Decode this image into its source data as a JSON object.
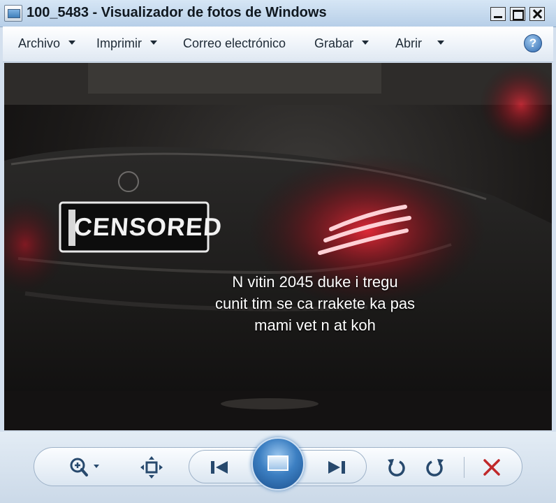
{
  "window": {
    "title": "100_5483 - Visualizador de fotos de Windows"
  },
  "menu": {
    "items": [
      {
        "label": "Archivo"
      },
      {
        "label": "Imprimir"
      },
      {
        "label": "Correo electrónico"
      },
      {
        "label": "Grabar"
      },
      {
        "label": "Abrir"
      }
    ],
    "help_symbol": "?"
  },
  "photo": {
    "plate_text": "CENSORED",
    "caption_lines": [
      "N vitin 2045 duke i tregu",
      "cunit tim se ca rrakete ka pas",
      "mami vet n at koh"
    ]
  },
  "toolbar": {
    "icons": [
      "zoom-icon",
      "actual-size-icon",
      "previous-icon",
      "slideshow-icon",
      "next-icon",
      "rotate-left-icon",
      "rotate-right-icon",
      "delete-icon"
    ]
  },
  "colors": {
    "taillight": "#ff2a3a",
    "delete": "#c0282a",
    "accent": "#3c7fc2"
  }
}
